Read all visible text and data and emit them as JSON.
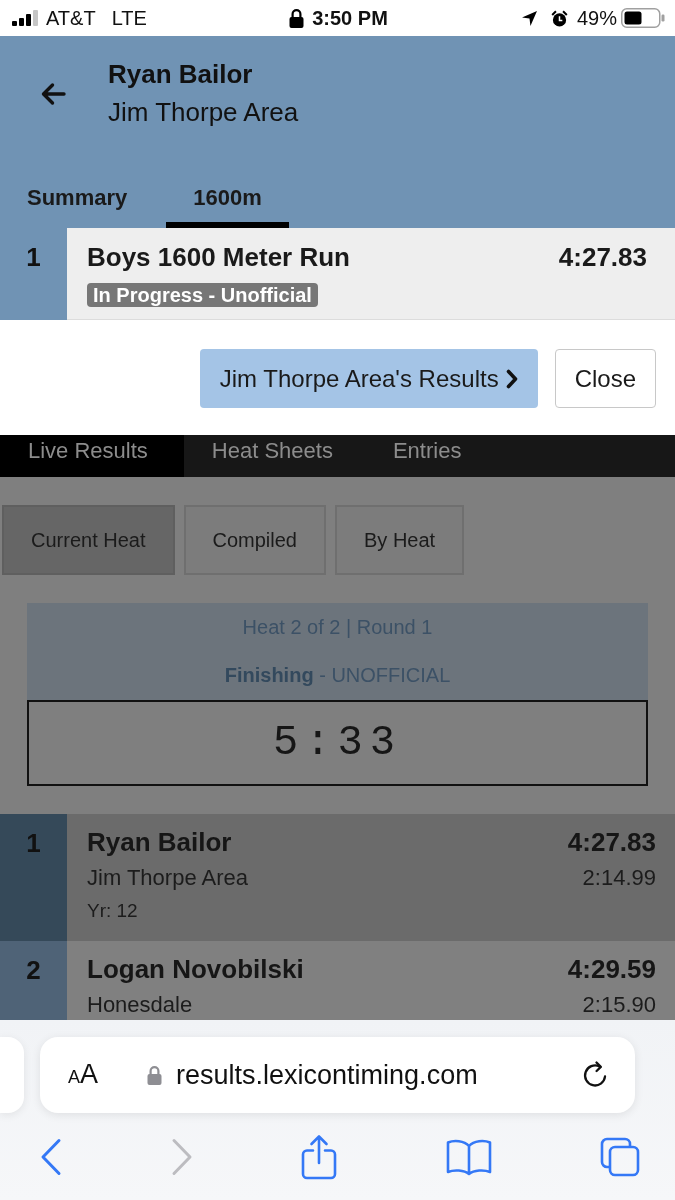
{
  "status_bar": {
    "carrier": "AT&T",
    "network": "LTE",
    "time": "3:50 PM",
    "battery": "49%"
  },
  "athlete_panel": {
    "name": "Ryan Bailor",
    "team": "Jim Thorpe Area",
    "tabs": [
      {
        "label": "Summary",
        "selected": false
      },
      {
        "label": "1600m",
        "selected": true
      }
    ],
    "event": {
      "place": "1",
      "name": "Boys 1600 Meter Run",
      "time": "4:27.83",
      "status": "In Progress - Unofficial"
    },
    "buttons": [
      {
        "kind": "primary",
        "label": "Jim Thorpe Area's Results"
      },
      {
        "kind": "secondary",
        "label": "Close"
      }
    ]
  },
  "page": {
    "nav_tabs": [
      {
        "label": "Live Results",
        "selected": true
      },
      {
        "label": "Heat Sheets",
        "selected": false
      },
      {
        "label": "Entries",
        "selected": false
      }
    ],
    "view_tabs": [
      {
        "label": "Current Heat",
        "selected": true
      },
      {
        "label": "Compiled",
        "selected": false
      },
      {
        "label": "By Heat",
        "selected": false
      }
    ],
    "heat": {
      "title": "Heat 2 of 2 | Round 1",
      "status": "**Finishing** - UNOFFICIAL",
      "clock": "5:33"
    },
    "results": [
      {
        "place": "1",
        "name": "Ryan Bailor",
        "team": "Jim Thorpe Area",
        "year": "Yr: 12",
        "time": "4:27.83",
        "split": "2:14.99",
        "selected": true
      },
      {
        "place": "2",
        "name": "Logan Novobilski",
        "team": "Honesdale",
        "time": "4:29.59",
        "split": "2:15.90",
        "selected": false
      }
    ]
  },
  "browser": {
    "text_size_button": "AA",
    "url": "results.lexicontiming.com",
    "toolbar": [
      {
        "kind": "back",
        "disabled": false
      },
      {
        "kind": "forward",
        "disabled": true
      },
      {
        "kind": "share",
        "disabled": false
      },
      {
        "kind": "bookmarks",
        "disabled": false
      },
      {
        "kind": "tabs",
        "disabled": false
      }
    ]
  }
}
